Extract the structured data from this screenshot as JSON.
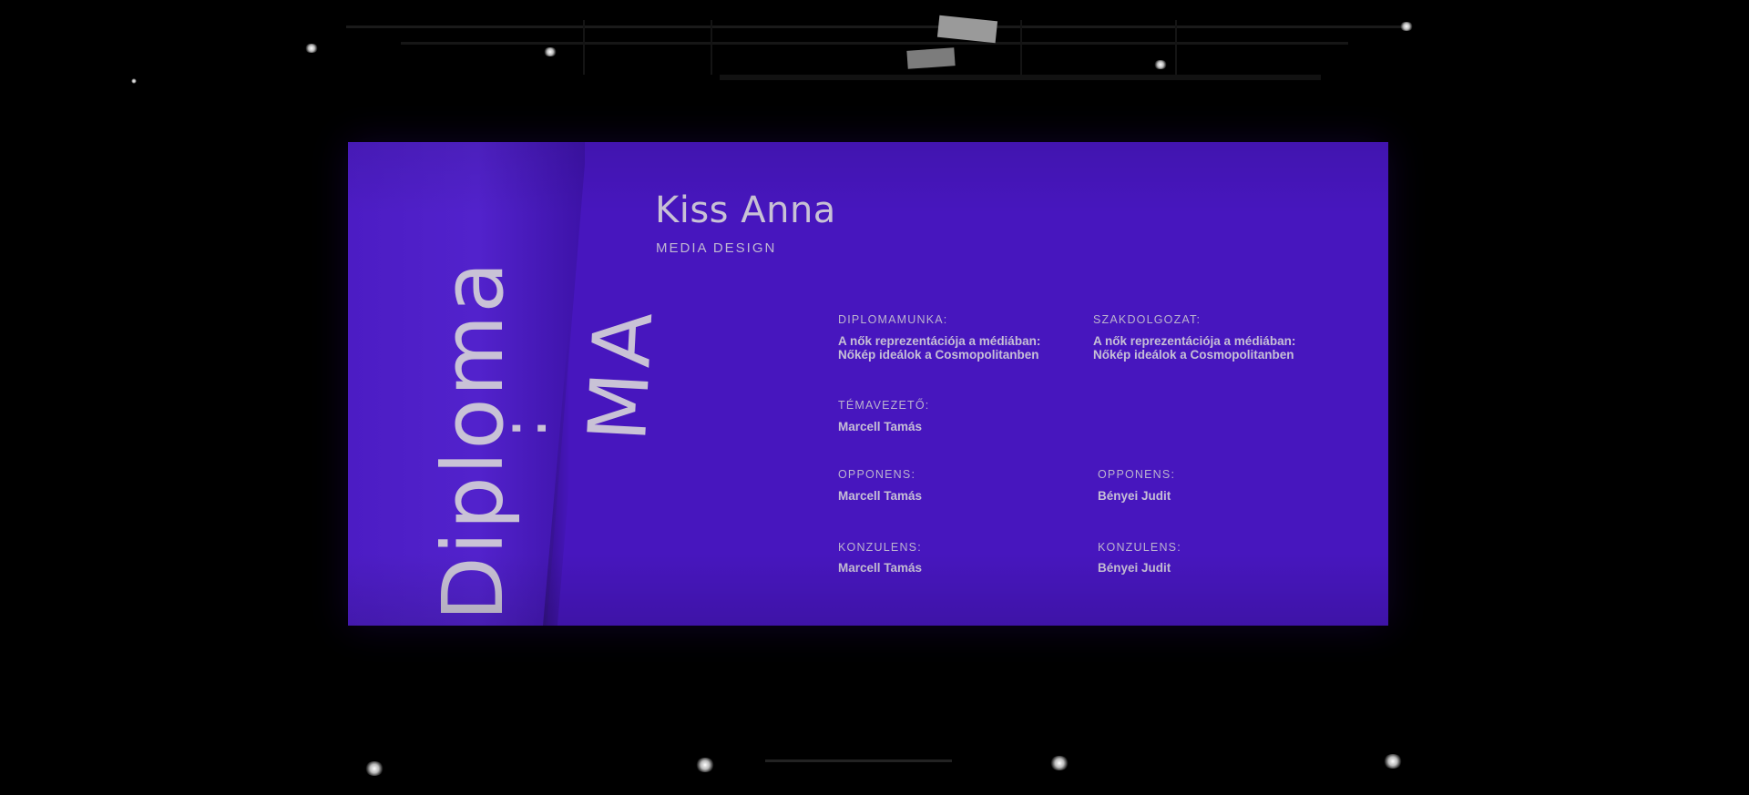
{
  "slide": {
    "banner": {
      "word": "Diploma",
      "colon": ":",
      "suffix": "MA"
    },
    "student": {
      "name": "Kiss Anna",
      "program": "MEDIA DESIGN"
    },
    "diplomamunka": {
      "label": "DIPLOMAMUNKA:",
      "line1": "A nők reprezentációja a médiában:",
      "line2": "Nőkép ideálok a Cosmopolitanben"
    },
    "szakdolgozat": {
      "label": "SZAKDOLGOZAT:",
      "line1": "A nők reprezentációja a médiában:",
      "line2": "Nőkép ideálok a Cosmopolitanben"
    },
    "temavezeto": {
      "label": "TÉMAVEZETŐ:",
      "value": "Marcell Tamás"
    },
    "opponens_left": {
      "label": "OPPONENS:",
      "value": "Marcell Tamás"
    },
    "opponens_right": {
      "label": "OPPONENS:",
      "value": "Bényei Judit"
    },
    "konzulens_left": {
      "label": "KONZULENS:",
      "value": "Marcell Tamás"
    },
    "konzulens_right": {
      "label": "KONZULENS:",
      "value": "Bényei Judit"
    }
  },
  "colors": {
    "screen": "#4716be",
    "text": "#c9c2d6",
    "background": "#000000"
  }
}
